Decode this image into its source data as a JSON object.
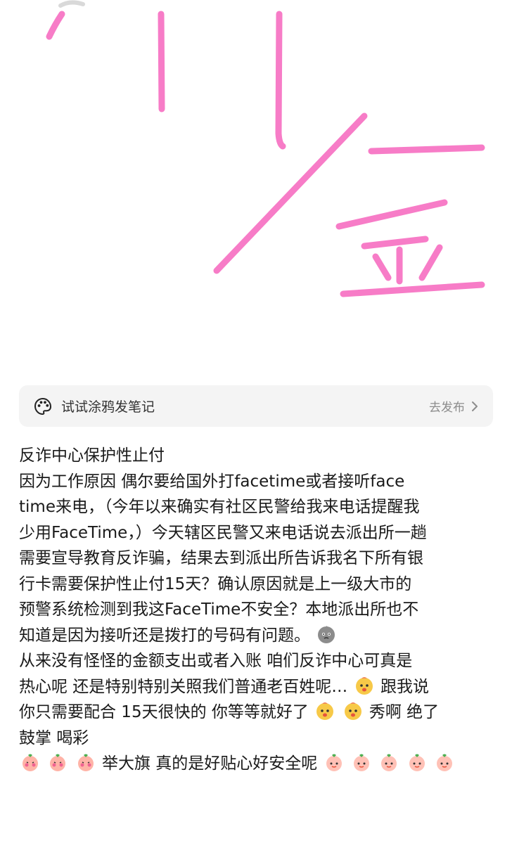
{
  "doodle": {
    "stroke_color": "#f77cc7",
    "drawing": "pink-handwriting"
  },
  "doodle_bar": {
    "icon": "palette-icon",
    "label": "试试涂鸦发笔记",
    "publish_label": "去发布",
    "chevron": "chevron-right-icon"
  },
  "post": {
    "lines": [
      "反诈中心保护性止付",
      "因为工作原因 偶尔要给国外打facetime或者接听face",
      "time来电，（今年以来确实有社区民警给我来电话提醒我",
      "少用FaceTime，）今天辖区民警又来电话说去派出所一趟",
      "需要宣导教育反诈骗，结果去到派出所告诉我名下所有银",
      "行卡需要保护性止付15天？确认原因就是上一级大市的",
      "预警系统检测到我这FaceTime不安全？本地派出所也不",
      "知道是因为接听还是拨打的号码有问题。",
      "从来没有怪怪的金额支出或者入账 咱们反诈中心可真是",
      "热心呢 还是特别特别关照我们普通老百姓呢…",
      "跟我说",
      "你只需要配合 15天很快的 你等等就好了",
      "秀啊 绝了",
      "鼓掌 喝彩",
      "举大旗 真的是好贴心好安全呢"
    ],
    "emoji_names": [
      "gray-face-emoji",
      "yellow-face-emoji",
      "peach-face-emoji",
      "peach-blush-emoji"
    ]
  }
}
